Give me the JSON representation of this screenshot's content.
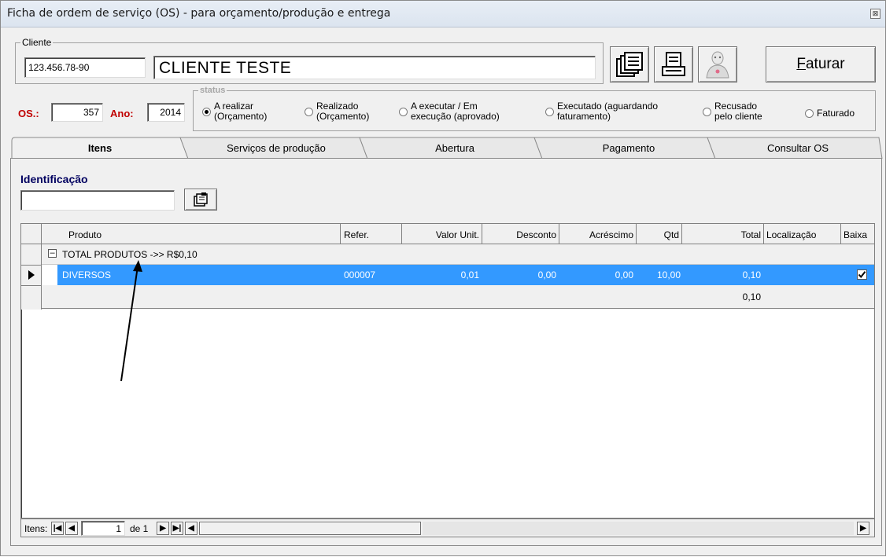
{
  "window": {
    "title": "Ficha de ordem de serviço (OS) - para orçamento/produção e entrega",
    "close_glyph": "⊠"
  },
  "cliente": {
    "legend": "Cliente",
    "code": "123.456.78-90",
    "name": "CLIENTE TESTE"
  },
  "toolbar": {
    "icons": [
      "documents-icon",
      "printer-icon",
      "user-icon"
    ],
    "faturar_label": "Faturar",
    "faturar_rest": "aturar",
    "faturar_mnemonic": "F"
  },
  "os": {
    "label": "OS.:",
    "value": "357",
    "ano_label": "Ano:",
    "ano_value": "2014"
  },
  "status": {
    "legend": "status",
    "options": [
      {
        "l1": "A realizar",
        "l2": "(Orçamento)",
        "selected": true
      },
      {
        "l1": "Realizado",
        "l2": "(Orçamento)",
        "selected": false
      },
      {
        "l1": "A executar / Em",
        "l2": "execução (aprovado)",
        "selected": false
      },
      {
        "l1": "Executado (aguardando",
        "l2": "faturamento)",
        "selected": false
      },
      {
        "l1": "Recusado",
        "l2": "pelo cliente",
        "selected": false
      },
      {
        "l1": "Faturado",
        "l2": "",
        "selected": false
      }
    ]
  },
  "tabs": [
    "Itens",
    "Serviços de produção",
    "Abertura",
    "Pagamento",
    "Consultar OS"
  ],
  "active_tab": "Itens",
  "identificacao": {
    "label": "Identificação",
    "value": ""
  },
  "grid": {
    "columns": [
      "Produto",
      "Refer.",
      "Valor Unit.",
      "Desconto",
      "Acréscimo",
      "Qtd",
      "Total",
      "Localização",
      "Baixa"
    ],
    "group": {
      "toggle": "–",
      "label": "TOTAL PRODUTOS ->> R$0,10"
    },
    "rows": [
      {
        "produto": "DIVERSOS",
        "refer": "000007",
        "valor_unit": "0,01",
        "desconto": "0,00",
        "acrescimo": "0,00",
        "qtd": "10,00",
        "total": "0,10",
        "localizacao": "",
        "baixa": true
      }
    ],
    "footer_total": "0,10",
    "selection_color": "#3399ff"
  },
  "navigator": {
    "label": "Itens:",
    "page": "1",
    "of_text": "de 1"
  }
}
